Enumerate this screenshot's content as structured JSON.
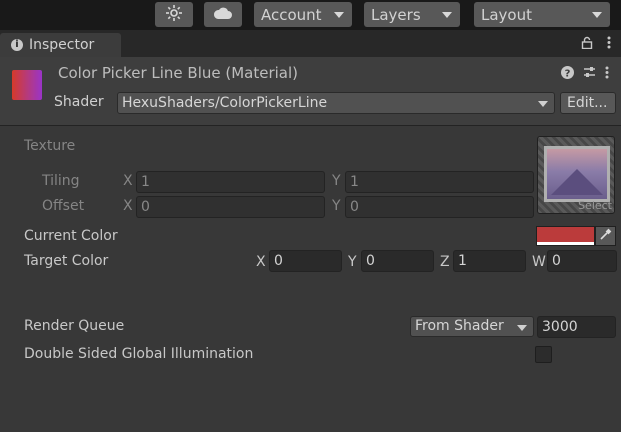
{
  "toolbar": {
    "account_label": "Account",
    "layers_label": "Layers",
    "layout_label": "Layout",
    "collab_icon": "collab-icon",
    "cloud_icon": "cloud-icon"
  },
  "tab": {
    "label": "Inspector",
    "icon": "info-icon"
  },
  "material": {
    "title": "Color Picker Line Blue (Material)",
    "shader_label": "Shader",
    "shader_value": "HexuShaders/ColorPickerLine",
    "edit_label": "Edit..."
  },
  "properties": {
    "texture_label": "Texture",
    "tiling_label": "Tiling",
    "tiling_x": "1",
    "tiling_y": "1",
    "offset_label": "Offset",
    "offset_x": "0",
    "offset_y": "0",
    "texture_select_label": "Select",
    "current_color_label": "Current Color",
    "current_color_value": "#bb3b3b",
    "target_color_label": "Target Color",
    "target_x": "0",
    "target_y": "0",
    "target_z": "1",
    "target_w": "0",
    "render_queue_label": "Render Queue",
    "render_queue_mode": "From Shader",
    "render_queue_value": "3000",
    "double_sided_gi_label": "Double Sided Global Illumination",
    "double_sided_gi_checked": false
  },
  "axes": {
    "x": "X",
    "y": "Y",
    "z": "Z",
    "w": "W"
  }
}
